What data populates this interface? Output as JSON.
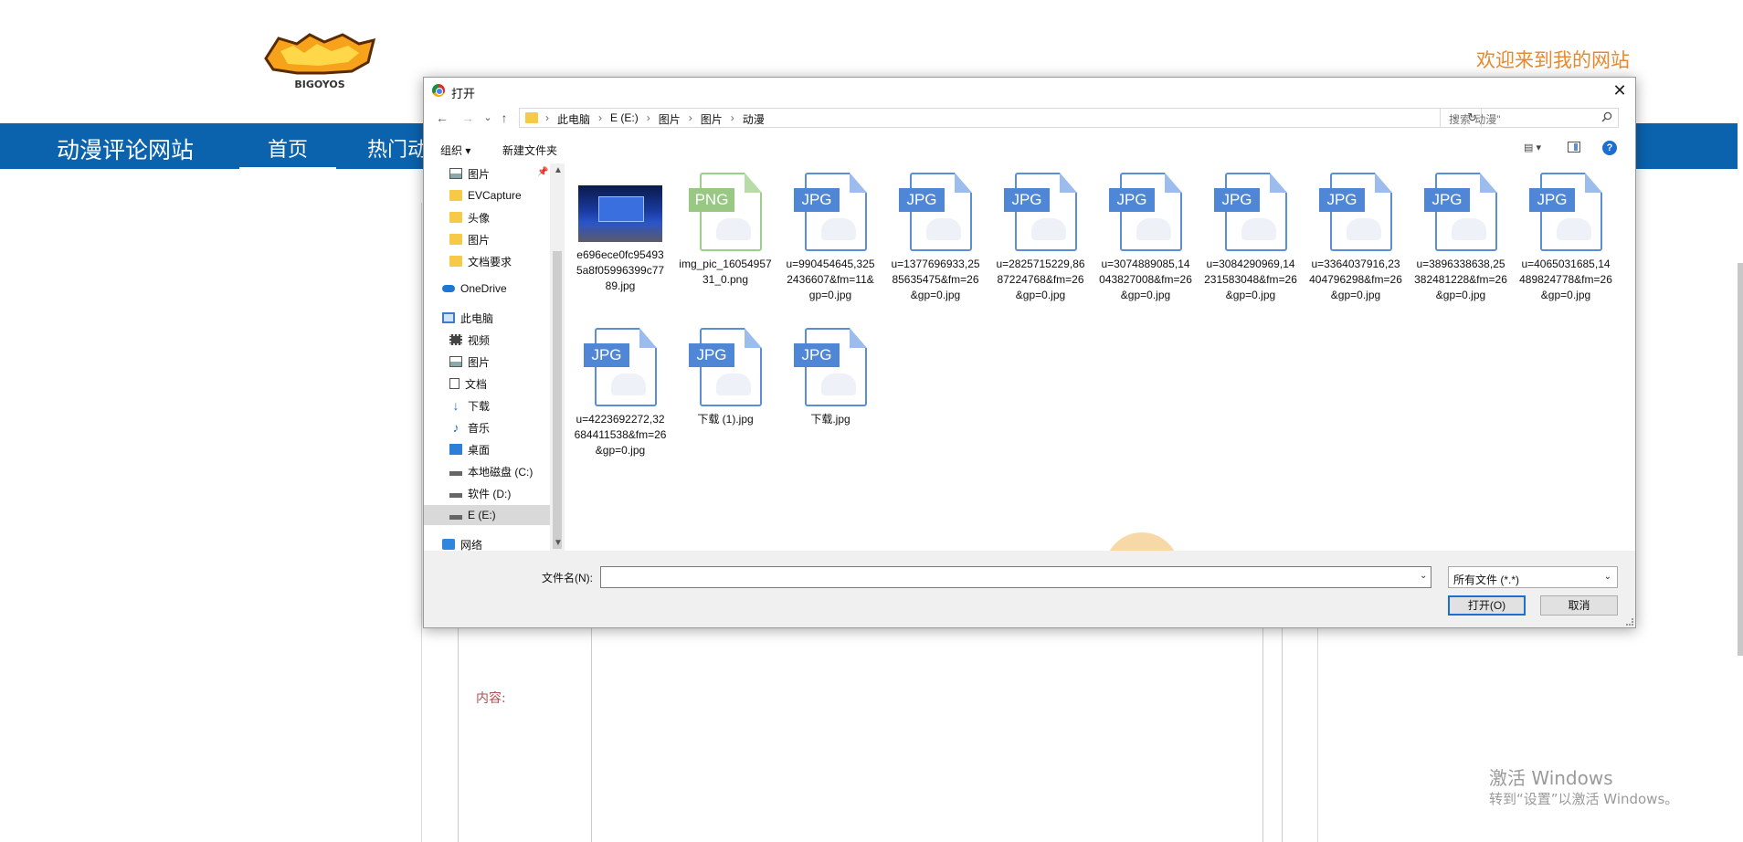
{
  "site": {
    "logo_text": "BIGOYOS",
    "welcome": "欢迎来到我的网站",
    "brand": "动漫评论网站",
    "nav": [
      "首页",
      "热门动"
    ],
    "content_label": "内容:"
  },
  "watermark": {
    "line1": "激活 Windows",
    "line2": "转到“设置”以激活 Windows。"
  },
  "dialog": {
    "title": "打开",
    "close": "✕",
    "back": "←",
    "forward": "→",
    "recent": "⌄",
    "up": "↑",
    "breadcrumbs": [
      "此电脑",
      "E (E:)",
      "图片",
      "图片",
      "动漫"
    ],
    "crumb_separator": "›",
    "address_dropdown": "⌄",
    "refresh": "↻",
    "search_placeholder": "搜索\"动漫\"",
    "toolbar": {
      "organize": "组织 ▾",
      "new_folder": "新建文件夹",
      "view": "▤ ▾",
      "help": "?"
    },
    "sidebar": [
      {
        "label": "图片",
        "icon": "picture-icon",
        "pinned": true
      },
      {
        "label": "EVCapture",
        "icon": "folder-icon"
      },
      {
        "label": "头像",
        "icon": "folder-icon"
      },
      {
        "label": "图片",
        "icon": "folder-icon"
      },
      {
        "label": "文档要求",
        "icon": "folder-icon"
      },
      {
        "label": "OneDrive",
        "icon": "onedrive-icon"
      },
      {
        "label": "此电脑",
        "icon": "computer-icon"
      },
      {
        "label": "视频",
        "icon": "video-icon"
      },
      {
        "label": "图片",
        "icon": "picture-icon"
      },
      {
        "label": "文档",
        "icon": "document-icon"
      },
      {
        "label": "下载",
        "icon": "download-icon"
      },
      {
        "label": "音乐",
        "icon": "music-icon"
      },
      {
        "label": "桌面",
        "icon": "desktop-icon"
      },
      {
        "label": "本地磁盘 (C:)",
        "icon": "drive-icon"
      },
      {
        "label": "软件 (D:)",
        "icon": "drive-icon"
      },
      {
        "label": "E (E:)",
        "icon": "drive-icon",
        "selected": true
      },
      {
        "label": "网络",
        "icon": "network-icon"
      }
    ],
    "files": [
      {
        "name": "e696ece0fc954935a8f05996399c7789.jpg",
        "kind": "image"
      },
      {
        "name": "img_pic_1605495731_0.png",
        "kind": "PNG"
      },
      {
        "name": "u=990454645,3252436607&fm=11&gp=0.jpg",
        "kind": "JPG"
      },
      {
        "name": "u=1377696933,2585635475&fm=26&gp=0.jpg",
        "kind": "JPG"
      },
      {
        "name": "u=2825715229,8687224768&fm=26&gp=0.jpg",
        "kind": "JPG"
      },
      {
        "name": "u=3074889085,14043827008&fm=26&gp=0.jpg",
        "kind": "JPG"
      },
      {
        "name": "u=3084290969,14231583048&fm=26&gp=0.jpg",
        "kind": "JPG"
      },
      {
        "name": "u=3364037916,23404796298&fm=26&gp=0.jpg",
        "kind": "JPG"
      },
      {
        "name": "u=3896338638,25382481228&fm=26&gp=0.jpg",
        "kind": "JPG"
      },
      {
        "name": "u=4065031685,14489824778&fm=26&gp=0.jpg",
        "kind": "JPG"
      },
      {
        "name": "u=4223692272,32684411538&fm=26&gp=0.jpg",
        "kind": "JPG"
      },
      {
        "name": "下载 (1).jpg",
        "kind": "JPG"
      },
      {
        "name": "下载.jpg",
        "kind": "JPG"
      }
    ],
    "filename_label": "文件名(N):",
    "filename_value": "",
    "filetype_value": "所有文件 (*.*)",
    "open_button": "打开(O)",
    "cancel_button": "取消",
    "dropdown_arrow": "⌄"
  }
}
